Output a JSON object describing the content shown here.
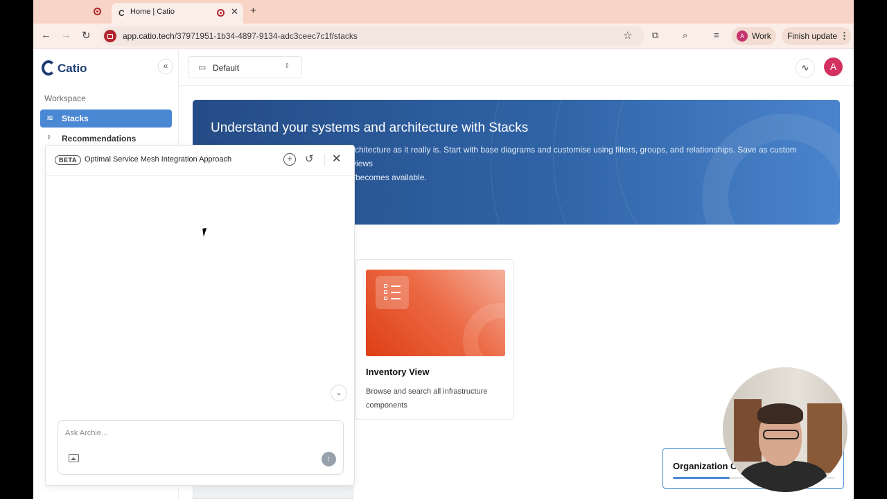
{
  "browser": {
    "active_tab_title": "Home | Catio",
    "tab_favicon": "C",
    "new_tab_glyph": "+",
    "url_host": "app.catio.tech",
    "url_path": "/37971951-1b34-4897-9134-adc3ceec7c1f/stacks",
    "profile_initial": "A",
    "profile_label": "Work",
    "finish_update_label": "Finish update"
  },
  "sidebar": {
    "brand": "Catio",
    "section_label": "Workspace",
    "items": [
      {
        "label": "Stacks",
        "icon": "layers-icon",
        "active": true
      },
      {
        "label": "Recommendations",
        "icon": "lightbulb-icon",
        "active": false
      }
    ]
  },
  "topbar": {
    "stack_selector_value": "Default",
    "user_initial": "A"
  },
  "hero": {
    "title": "Understand your systems and architecture with Stacks",
    "description_visible_right": "rchitecture as it really is. Start with base diagrams and customise using filters, groups, and relationships. Save as custom views",
    "description_visible_line2": "becomes available."
  },
  "cards": [
    {
      "title": "Inventory View",
      "description": "Browse and search all infrastructure components"
    }
  ],
  "org_card": {
    "label": "Organization C",
    "progress": 0.35
  },
  "chat": {
    "badge": "BETA",
    "title": "Optimal Service Mesh Integration Approach",
    "input_placeholder": "Ask Archie...",
    "input_value": ""
  },
  "colors": {
    "accent_blue": "#4a88d4",
    "brand_navy": "#1b3c73",
    "avatar_pink": "#d2305f",
    "tab_bar": "#f7d4c6"
  }
}
